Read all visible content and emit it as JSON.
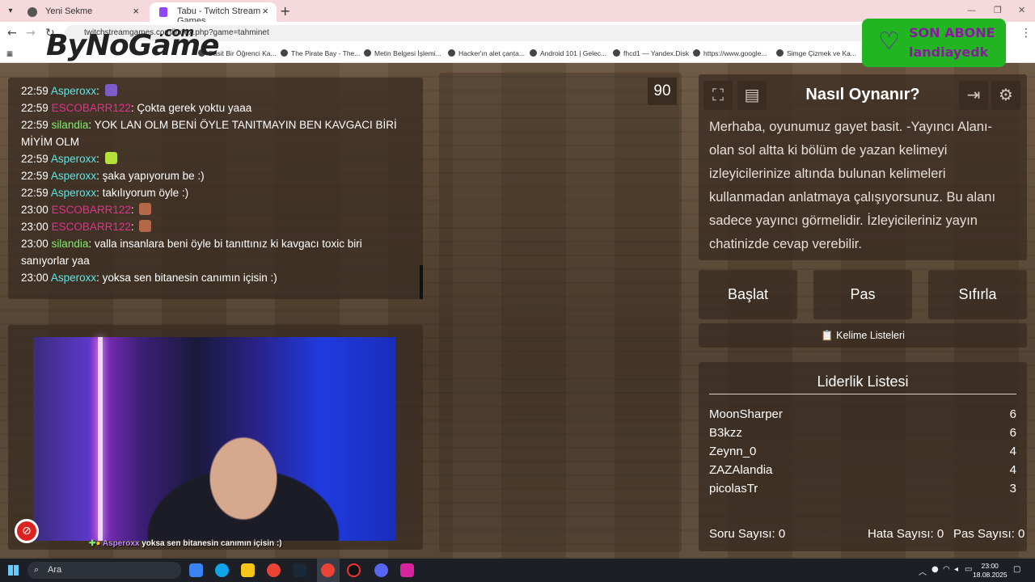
{
  "browser": {
    "tabs": [
      {
        "label": "Yeni Sekme"
      },
      {
        "label": "Tabu - Twitch Stream Games"
      }
    ],
    "url": "twitchstreamgames.com/index.php?game=tahminet",
    "bookmarks": [
      "Basit Bir Öğrenci Ka...",
      "The Pirate Bay - The...",
      "Metin Belgesi İşlemi...",
      "Hacker'ın alet çanta...",
      "Android 101 | Gelec...",
      "fhcd1 — Yandex.Disk",
      "https://www.google...",
      "Simge Çizmek ve Ka..."
    ]
  },
  "overlay": {
    "logo": "ByNoGame",
    "logo_suffix": ".com",
    "sub_alert": {
      "title": "SON ABONE",
      "name": "landiayedk",
      "accent": "#22b522"
    }
  },
  "chat": {
    "colors": {
      "Asperoxx": "#5ce6e6",
      "ESCOBARR122": "#e0338e",
      "silandia": "#7cf06a"
    },
    "messages": [
      {
        "time": "22:59",
        "user": "Asperoxx",
        "text": "",
        "emote": "purple-emote"
      },
      {
        "time": "22:59",
        "user": "ESCOBARR122",
        "text": "Çokta gerek yoktu yaaa",
        "emote": ""
      },
      {
        "time": "22:59",
        "user": "silandia",
        "text": "YOK LAN OLM BENİ ÖYLE TANITMAYIN BEN KAVGACI BİRİ MİYİM OLM",
        "emote": ""
      },
      {
        "time": "22:59",
        "user": "Asperoxx",
        "text": "",
        "emote": "green-emote"
      },
      {
        "time": "22:59",
        "user": "Asperoxx",
        "text": "şaka yapıyorum be :)",
        "emote": ""
      },
      {
        "time": "22:59",
        "user": "Asperoxx",
        "text": "takılıyorum öyle :)",
        "emote": ""
      },
      {
        "time": "23:00",
        "user": "ESCOBARR122",
        "text": "",
        "emote": "face-emote"
      },
      {
        "time": "23:00",
        "user": "ESCOBARR122",
        "text": "",
        "emote": "face-emote"
      },
      {
        "time": "23:00",
        "user": "silandia",
        "text": "valla insanlara beni öyle bi tanıttınız ki kavgacı toxic biri sanıyorlar yaa",
        "emote": ""
      },
      {
        "time": "23:00",
        "user": "Asperoxx",
        "text": "yoksa sen bitanesin canımın içisin :)",
        "emote": ""
      }
    ]
  },
  "webcam": {
    "caption_user": "Asperoxx",
    "caption_text": "yoksa sen bitanesin canımın içisin :)"
  },
  "game": {
    "timer": "90",
    "info_title": "Nasıl Oynanır?",
    "info_text": "Merhaba, oyunumuz gayet basit. -Yayıncı Alanı- olan sol altta ki bölüm de yazan kelimeyi izleyicilerinize altında bulunan kelimeleri kullanmadan anlatmaya çalışıyorsunuz. Bu alanı sadece yayıncı görmelidir. İzleyicileriniz yayın chatinizde cevap verebilir.",
    "buttons": {
      "start": "Başlat",
      "pass": "Pas",
      "reset": "Sıfırla"
    },
    "word_lists": "Kelime Listeleri",
    "leaderboard": {
      "title": "Liderlik Listesi",
      "rows": [
        {
          "name": "MoonSharper",
          "score": "6"
        },
        {
          "name": "B3kzz",
          "score": "6"
        },
        {
          "name": "Zeynn_0",
          "score": "4"
        },
        {
          "name": "ZAZAlandia",
          "score": "4"
        },
        {
          "name": "picolasTr",
          "score": "3"
        }
      ]
    },
    "stats": {
      "questions": "Soru Sayısı: 0",
      "errors": "Hata Sayısı: 0",
      "passes": "Pas Sayısı: 0"
    }
  },
  "taskbar": {
    "search_placeholder": "Ara",
    "time": "23:00",
    "date": "18.08.2025"
  }
}
